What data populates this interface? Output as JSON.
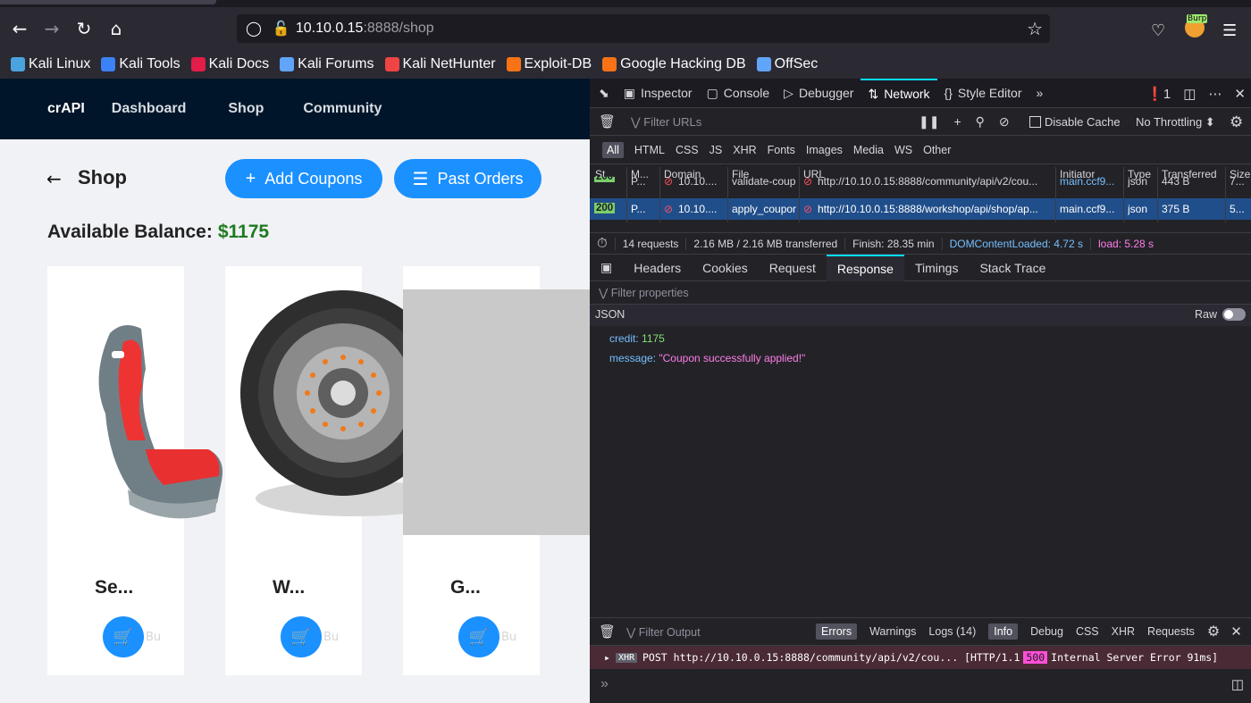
{
  "browser": {
    "url_host": "10.10.0.15",
    "url_rest": ":8888/shop",
    "burp_label": "Burp",
    "bookmarks": [
      {
        "label": "Kali Linux",
        "color": "#4aa3df"
      },
      {
        "label": "Kali Tools",
        "color": "#3b82f6"
      },
      {
        "label": "Kali Docs",
        "color": "#e11d48"
      },
      {
        "label": "Kali Forums",
        "color": "#60a5fa"
      },
      {
        "label": "Kali NetHunter",
        "color": "#ef4444"
      },
      {
        "label": "Exploit-DB",
        "color": "#f97316"
      },
      {
        "label": "Google Hacking DB",
        "color": "#f97316"
      },
      {
        "label": "OffSec",
        "color": "#60a5fa"
      }
    ]
  },
  "app": {
    "brand": "crAPI",
    "nav": [
      "Dashboard",
      "Shop",
      "Community"
    ],
    "page_title": "Shop",
    "add_coupons": "Add Coupons",
    "past_orders": "Past Orders",
    "balance_label": "Available Balance:",
    "balance_value": "$1175",
    "products": [
      {
        "name": "Se..."
      },
      {
        "name": "W..."
      },
      {
        "name": "G..."
      }
    ],
    "buy_ghost": "Bu"
  },
  "devtools": {
    "tabs": [
      "Inspector",
      "Console",
      "Debugger",
      "Network",
      "Style Editor"
    ],
    "error_count": "1",
    "filter_urls_placeholder": "Filter URLs",
    "disable_cache": "Disable Cache",
    "throttling": "No Throttling ⬍",
    "type_filters": [
      "All",
      "HTML",
      "CSS",
      "JS",
      "XHR",
      "Fonts",
      "Images",
      "Media",
      "WS",
      "Other"
    ],
    "columns": [
      "St...",
      "M...",
      "Domain",
      "File",
      "URL",
      "Initiator",
      "Type",
      "Transferred",
      "Size"
    ],
    "requests": [
      {
        "status": "200",
        "method": "P...",
        "domain": "10.10....",
        "file": "validate-coup",
        "url": "http://10.10.0.15:8888/community/api/v2/cou...",
        "initiator": "main.ccf9...",
        "type": "json",
        "transferred": "443 B",
        "size": "7..."
      },
      {
        "status": "200",
        "method": "P...",
        "domain": "10.10....",
        "file": "apply_coupor",
        "url": "http://10.10.0.15:8888/workshop/api/shop/ap...",
        "initiator": "main.ccf9...",
        "type": "json",
        "transferred": "375 B",
        "size": "5..."
      }
    ],
    "summary": {
      "requests": "14 requests",
      "transferred": "2.16 MB / 2.16 MB transferred",
      "finish": "Finish: 28.35 min",
      "domcontent": "DOMContentLoaded: 4.72 s",
      "load": "load: 5.28 s"
    },
    "detail_tabs": [
      "Headers",
      "Cookies",
      "Request",
      "Response",
      "Timings",
      "Stack Trace"
    ],
    "filter_props": "Filter properties",
    "json_label": "JSON",
    "raw_label": "Raw",
    "response": {
      "credit_key": "credit:",
      "credit_val": "1175",
      "message_key": "message:",
      "message_val": "\"Coupon successfully applied!\""
    },
    "console": {
      "filter_output": "Filter Output",
      "filters": [
        "Errors",
        "Warnings",
        "Logs (14)",
        "Info",
        "Debug",
        "CSS",
        "XHR",
        "Requests"
      ],
      "message_method": "POST",
      "message_url": "http://10.10.0.15:8888/community/api/v2/cou...",
      "message_proto": "[HTTP/1.1",
      "message_code": "500",
      "message_status": "Internal Server Error 91ms]",
      "xhr_tag": "XHR"
    }
  }
}
